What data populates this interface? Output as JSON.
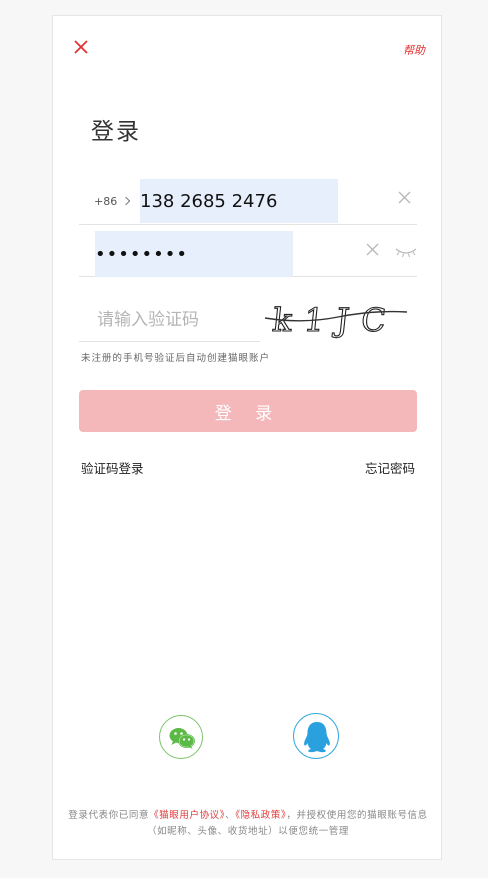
{
  "header": {
    "help_label": "帮助"
  },
  "title": "登录",
  "phone": {
    "prefix": "+86",
    "value": "138 2685 2476"
  },
  "password": {
    "value": "••••••••"
  },
  "verify": {
    "placeholder": "请输入验证码",
    "captcha_text": "k1JC"
  },
  "hint": "未注册的手机号验证后自动创建猫眼账户",
  "login_button": "登 录",
  "links": {
    "code_login": "验证码登录",
    "forgot_password": "忘记密码"
  },
  "agreement": {
    "prefix": "登录代表你已同意",
    "user_agreement": "《猫眼用户协议》",
    "sep": "、",
    "privacy": "《隐私政策》",
    "suffix": "，并授权使用您的猫眼账号信息（如昵称、头像、收货地址）以便您统一管理"
  },
  "colors": {
    "accent": "#e03030",
    "button_disabled": "#f5b8ba",
    "wechat": "#5bb946",
    "qq": "#2aa0de",
    "autofill": "#e7effd"
  }
}
